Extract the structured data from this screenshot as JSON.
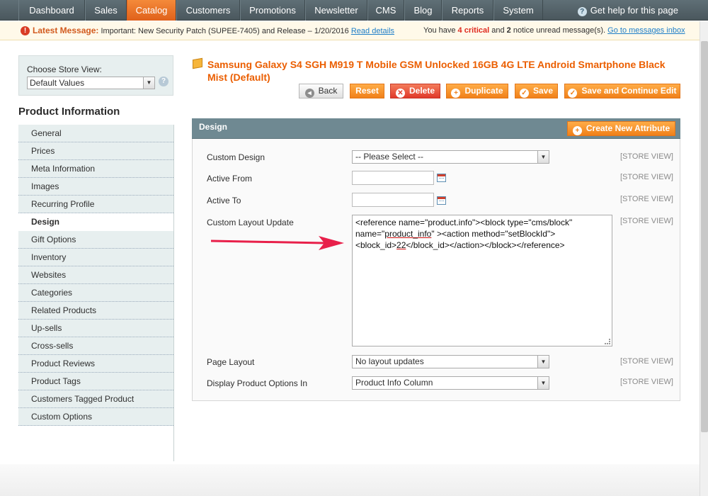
{
  "nav": {
    "items": [
      "Dashboard",
      "Sales",
      "Catalog",
      "Customers",
      "Promotions",
      "Newsletter",
      "CMS",
      "Blog",
      "Reports",
      "System"
    ],
    "active": "Catalog",
    "help_label": "Get help for this page"
  },
  "message": {
    "label": "Latest Message:",
    "text": "Important: New Security Patch (SUPEE-7405) and Release – 1/20/2016",
    "link": "Read details",
    "summary_pre": "You have",
    "critical_count": "4 critical",
    "summary_mid": "and",
    "notice_count": "2",
    "summary_post": "notice unread message(s).",
    "inbox_link": "Go to messages inbox"
  },
  "store": {
    "label": "Choose Store View:",
    "value": "Default Values"
  },
  "sidebar": {
    "title": "Product Information",
    "items": [
      "General",
      "Prices",
      "Meta Information",
      "Images",
      "Recurring Profile",
      "Design",
      "Gift Options",
      "Inventory",
      "Websites",
      "Categories",
      "Related Products",
      "Up-sells",
      "Cross-sells",
      "Product Reviews",
      "Product Tags",
      "Customers Tagged Product",
      "Custom Options"
    ],
    "active": "Design"
  },
  "product": {
    "title": "Samsung Galaxy S4 SGH M919 T Mobile GSM Unlocked 16GB 4G LTE Android Smartphone Black Mist (Default)"
  },
  "toolbar": {
    "back": "Back",
    "reset": "Reset",
    "delete": "Delete",
    "duplicate": "Duplicate",
    "save": "Save",
    "save_continue": "Save and Continue Edit"
  },
  "design": {
    "heading": "Design",
    "create_attribute": "Create New Attribute",
    "scope_label": "[STORE VIEW]",
    "fields": {
      "custom_design": {
        "label": "Custom Design",
        "value": "-- Please Select --"
      },
      "active_from": {
        "label": "Active From",
        "value": ""
      },
      "active_to": {
        "label": "Active To",
        "value": ""
      },
      "layout_update": {
        "label": "Custom Layout Update",
        "line1": "<reference name=\"product.info\"><block type=\"cms/block\"",
        "line2_a": "name=\"",
        "line2_u": "product_info",
        "line2_b": "\" ><action method=\"setBlockId\">",
        "line3_a": "<block_id>",
        "line3_u": "22",
        "line3_b": "</block_id></action></block></reference>"
      },
      "page_layout": {
        "label": "Page Layout",
        "value": "No layout updates"
      },
      "options_in": {
        "label": "Display Product Options In",
        "value": "Product Info Column"
      }
    }
  },
  "colors": {
    "accent": "#eb5e00",
    "nav_bg": "#56656c",
    "annotation_arrow": "#e8204a"
  }
}
